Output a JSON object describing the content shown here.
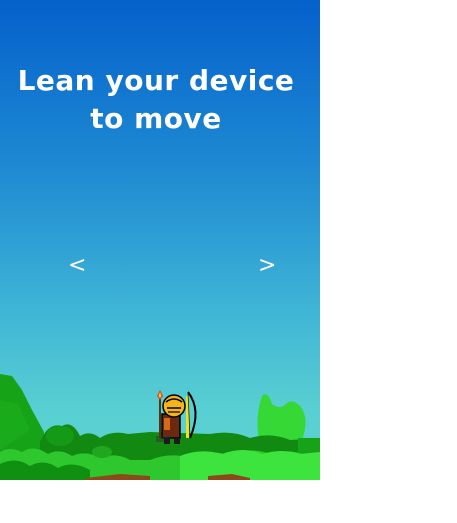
{
  "instruction": {
    "line1": "Lean your device",
    "line2": "to move"
  },
  "controls": {
    "left_arrow": "<",
    "right_arrow": ">"
  },
  "colors": {
    "sky_top": "#0560cc",
    "sky_bottom": "#5dd3cf",
    "grass": "#22b822",
    "bush_dark": "#128a12",
    "bush_light": "#35d835",
    "dirt": "#8a4a1a"
  },
  "player": {
    "icon": "archer-character"
  }
}
